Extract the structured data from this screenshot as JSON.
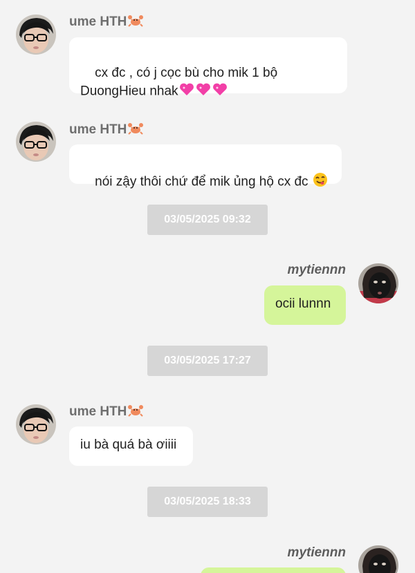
{
  "colors": {
    "background": "#f3f3f3",
    "incoming_bubble": "#ffffff",
    "outgoing_bubble": "#d5f59a",
    "timestamp_bg": "#d6d6d6",
    "timestamp_text": "#ffffff",
    "sender_name": "#6e6e6e"
  },
  "contacts": {
    "other": {
      "name": "ume HTH",
      "name_emoji": "crab-emoji"
    },
    "me": {
      "name": "mytiennn"
    }
  },
  "messages": [
    {
      "type": "incoming",
      "sender": "ume HTH",
      "text": "cx đc , có j cọc bù cho mik 1 bộ DuongHieu nhak",
      "trailing_emoji": "three-pink-hearts"
    },
    {
      "type": "incoming",
      "sender": "ume HTH",
      "text": "nói zậy thôi chứ để mik ủng hộ cx đc",
      "trailing_emoji": "yum-face"
    },
    {
      "type": "timestamp",
      "text": "03/05/2025 09:32"
    },
    {
      "type": "outgoing",
      "sender": "mytiennn",
      "text": "ocii lunnn"
    },
    {
      "type": "timestamp",
      "text": "03/05/2025 17:27"
    },
    {
      "type": "incoming",
      "sender": "ume HTH",
      "text": "iu bà quá bà ơiiii"
    },
    {
      "type": "timestamp",
      "text": "03/05/2025 18:33"
    },
    {
      "type": "outgoing",
      "sender": "mytiennn",
      "text": ""
    }
  ]
}
